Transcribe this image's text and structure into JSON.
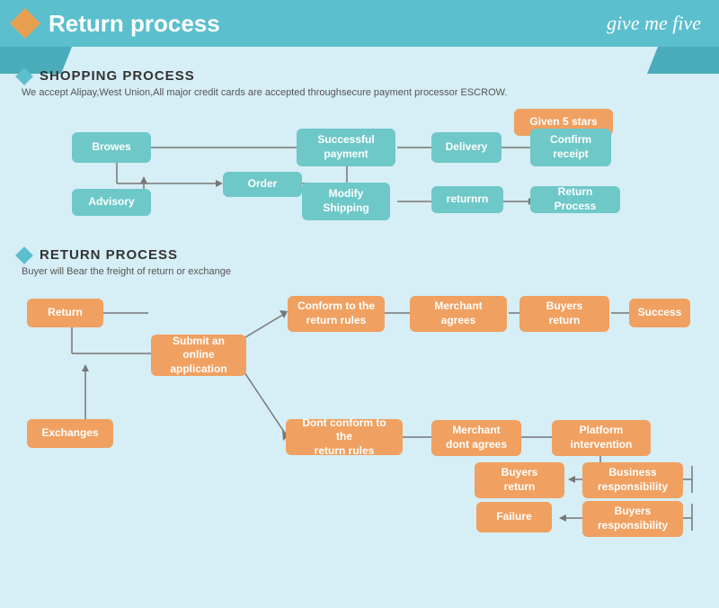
{
  "header": {
    "title": "Return process",
    "script_text": "give me five"
  },
  "shopping_section": {
    "title": "SHOPPING PROCESS",
    "subtitle": "We accept Alipay,West Union,All major credit cards are accepted throughsecure payment processor ESCROW.",
    "boxes": {
      "browes": "Browes",
      "order": "Order",
      "advisory": "Advisory",
      "modify_shipping": "Modify\nShipping",
      "successful_payment": "Successful\npayment",
      "delivery": "Delivery",
      "confirm_receipt": "Confirm\nreceipt",
      "given_5_stars": "Given 5 stars",
      "returnrn": "returnrn",
      "return_process": "Return Process"
    }
  },
  "return_section": {
    "title": "RETURN PROCESS",
    "subtitle": "Buyer will Bear the freight of return or exchange",
    "boxes": {
      "return": "Return",
      "exchanges": "Exchanges",
      "submit_online": "Submit an online\napplication",
      "conform_rules": "Conform to the\nreturn rules",
      "dont_conform_rules": "Dont conform to the\nreturn rules",
      "merchant_agrees": "Merchant\nagrees",
      "merchant_dont_agrees": "Merchant\ndont agrees",
      "buyers_return_1": "Buyers\nreturn",
      "buyers_return_2": "Buyers\nreturn",
      "platform_intervention": "Platform\nintervention",
      "success": "Success",
      "business_responsibility": "Business\nresponsibility",
      "buyers_responsibility": "Buyers\nresponsibility",
      "failure": "Failure"
    }
  }
}
